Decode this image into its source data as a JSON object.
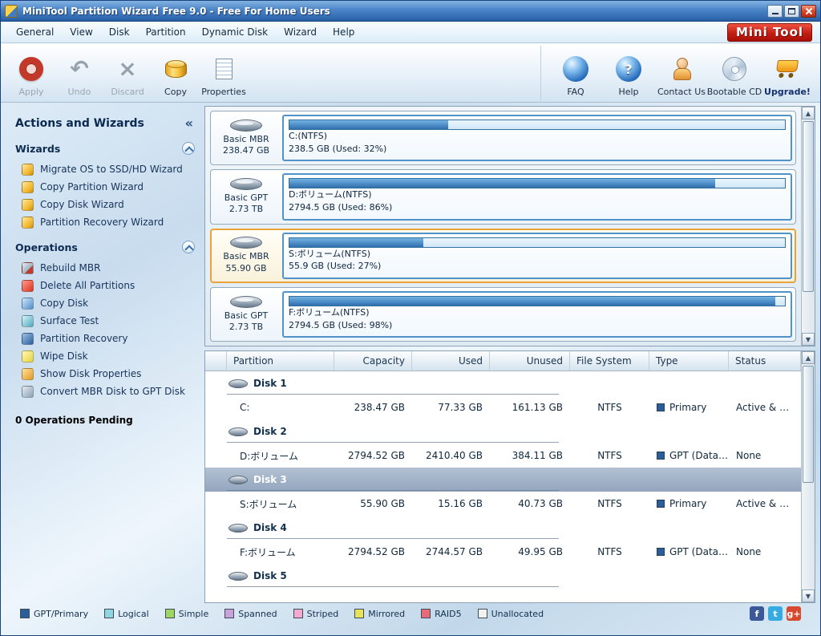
{
  "window": {
    "title": "MiniTool Partition Wizard Free 9.0 - Free For Home Users"
  },
  "menu": {
    "items": [
      "General",
      "View",
      "Disk",
      "Partition",
      "Dynamic Disk",
      "Wizard",
      "Help"
    ],
    "logo": "Mini Tool"
  },
  "icons": {
    "undo": "↶",
    "discard": "×",
    "question": "?",
    "scroll_up": "▲",
    "scroll_down": "▼",
    "collapse_left": "«"
  },
  "toolbar": {
    "left": [
      {
        "label": "Apply",
        "disabled": true
      },
      {
        "label": "Undo",
        "disabled": true
      },
      {
        "label": "Discard",
        "disabled": true
      },
      {
        "label": "Copy",
        "disabled": false
      },
      {
        "label": "Properties",
        "disabled": false
      }
    ],
    "right": [
      {
        "label": "FAQ"
      },
      {
        "label": "Help"
      },
      {
        "label": "Contact Us"
      },
      {
        "label": "Bootable CD"
      },
      {
        "label": "Upgrade!"
      }
    ]
  },
  "sidebar": {
    "title": "Actions and Wizards",
    "sections": [
      {
        "title": "Wizards",
        "items": [
          {
            "label": "Migrate OS to SSD/HD Wizard",
            "icon": "migrate-os-wizard-icon"
          },
          {
            "label": "Copy Partition Wizard",
            "icon": "copy-partition-wizard-icon"
          },
          {
            "label": "Copy Disk Wizard",
            "icon": "copy-disk-wizard-icon"
          },
          {
            "label": "Partition Recovery Wizard",
            "icon": "partition-recovery-wizard-icon"
          }
        ]
      },
      {
        "title": "Operations",
        "items": [
          {
            "label": "Rebuild MBR",
            "icon": "rebuild-mbr-icon"
          },
          {
            "label": "Delete All Partitions",
            "icon": "delete-all-partitions-icon"
          },
          {
            "label": "Copy Disk",
            "icon": "copy-disk-icon"
          },
          {
            "label": "Surface Test",
            "icon": "surface-test-icon"
          },
          {
            "label": "Partition Recovery",
            "icon": "partition-recovery-icon"
          },
          {
            "label": "Wipe Disk",
            "icon": "wipe-disk-icon"
          },
          {
            "label": "Show Disk Properties",
            "icon": "disk-properties-icon"
          },
          {
            "label": "Convert MBR Disk to GPT Disk",
            "icon": "convert-mbr-gpt-icon"
          }
        ]
      }
    ],
    "pending": "0 Operations Pending"
  },
  "disk_map": [
    {
      "disk_type": "Basic MBR",
      "disk_size": "238.47 GB",
      "label": "C:(NTFS)",
      "info": "238.5 GB (Used: 32%)",
      "used_pct": 32,
      "selected": false
    },
    {
      "disk_type": "Basic GPT",
      "disk_size": "2.73 TB",
      "label": "D:ボリューム(NTFS)",
      "info": "2794.5 GB (Used: 86%)",
      "used_pct": 86,
      "selected": false
    },
    {
      "disk_type": "Basic MBR",
      "disk_size": "55.90 GB",
      "label": "S:ボリューム(NTFS)",
      "info": "55.9 GB (Used: 27%)",
      "used_pct": 27,
      "selected": true
    },
    {
      "disk_type": "Basic GPT",
      "disk_size": "2.73 TB",
      "label": "F:ボリューム(NTFS)",
      "info": "2794.5 GB (Used: 98%)",
      "used_pct": 98,
      "selected": false
    }
  ],
  "table": {
    "columns": [
      "Partition",
      "Capacity",
      "Used",
      "Unused",
      "File System",
      "Type",
      "Status"
    ],
    "rows": [
      {
        "kind": "group",
        "label": "Disk 1"
      },
      {
        "kind": "part",
        "partition": "C:",
        "capacity": "238.47 GB",
        "used": "77.33 GB",
        "unused": "161.13 GB",
        "file_system": "NTFS",
        "ptype": "Primary",
        "type_color": "#2b5d9b",
        "status": "Active & Sy…"
      },
      {
        "kind": "group",
        "label": "Disk 2"
      },
      {
        "kind": "part",
        "partition": "D:ボリューム",
        "capacity": "2794.52 GB",
        "used": "2410.40 GB",
        "unused": "384.11 GB",
        "file_system": "NTFS",
        "ptype": "GPT (Data…",
        "type_color": "#2b5d9b",
        "status": "None"
      },
      {
        "kind": "group",
        "label": "Disk 3",
        "selected": true
      },
      {
        "kind": "part",
        "partition": "S:ボリューム",
        "capacity": "55.90 GB",
        "used": "15.16 GB",
        "unused": "40.73 GB",
        "file_system": "NTFS",
        "ptype": "Primary",
        "type_color": "#2b5d9b",
        "status": "Active & Boot"
      },
      {
        "kind": "group",
        "label": "Disk 4"
      },
      {
        "kind": "part",
        "partition": "F:ボリューム",
        "capacity": "2794.52 GB",
        "used": "2744.57 GB",
        "unused": "49.95 GB",
        "file_system": "NTFS",
        "ptype": "GPT (Data…",
        "type_color": "#2b5d9b",
        "status": "None"
      },
      {
        "kind": "group",
        "label": "Disk 5"
      }
    ]
  },
  "legend": {
    "items": [
      {
        "label": "GPT/Primary",
        "color": "#2b5d9b"
      },
      {
        "label": "Logical",
        "color": "#8ed6e0"
      },
      {
        "label": "Simple",
        "color": "#9ed65e"
      },
      {
        "label": "Spanned",
        "color": "#c8a2d8"
      },
      {
        "label": "Striped",
        "color": "#f4aace"
      },
      {
        "label": "Mirrored",
        "color": "#e6e35a"
      },
      {
        "label": "RAID5",
        "color": "#e66b7a"
      },
      {
        "label": "Unallocated",
        "color": "#f2f2ee"
      }
    ]
  },
  "social": [
    {
      "name": "facebook",
      "color": "#3b5998",
      "glyph": "f"
    },
    {
      "name": "twitter",
      "color": "#35abe2",
      "glyph": "t"
    },
    {
      "name": "google-plus",
      "color": "#d6492f",
      "glyph": "g+"
    }
  ]
}
